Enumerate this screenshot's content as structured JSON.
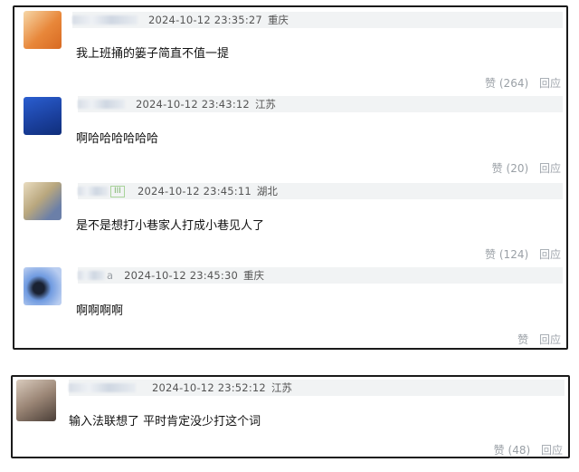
{
  "comments": [
    {
      "time": "2024-10-12 23:35:27",
      "region": "重庆",
      "text": "我上班捅的篓子简直不值一提",
      "like": "赞",
      "count": "(264)",
      "reply": "回应",
      "avatar_color": "#e8873a"
    },
    {
      "time": "2024-10-12 23:43:12",
      "region": "江苏",
      "text": "啊哈哈哈哈哈哈",
      "like": "赞",
      "count": "(20)",
      "reply": "回应",
      "avatar_color": "#1f4fb8"
    },
    {
      "time": "2024-10-12 23:45:11",
      "region": "湖北",
      "text": "是不是想打小巷家人打成小巷见人了",
      "like": "赞",
      "count": "(124)",
      "reply": "回应",
      "avatar_color": "#c9b58a",
      "badge": "III"
    },
    {
      "time": "2024-10-12 23:45:30",
      "region": "重庆",
      "text": "啊啊啊啊",
      "like": "赞",
      "count": "",
      "reply": "回应",
      "avatar_color": "#4a7fd0",
      "name_suffix": "a"
    },
    {
      "time": "2024-10-12 23:52:12",
      "region": "江苏",
      "text": "输入法联想了 平时肯定没少打这个词",
      "like": "赞",
      "count": "(48)",
      "reply": "回应",
      "avatar_color": "#8a7a6a"
    }
  ]
}
